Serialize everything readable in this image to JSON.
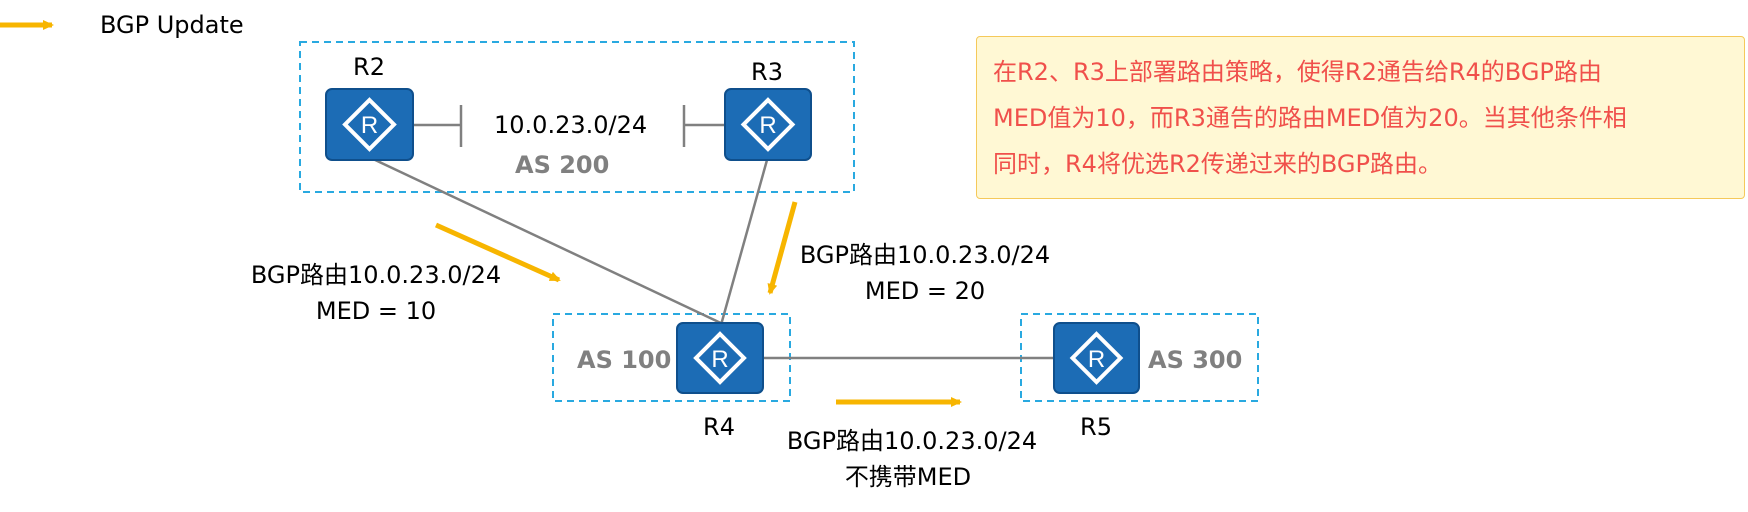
{
  "colors": {
    "as_box_border": "#29a9e0",
    "router_fill": "#1c6cb5",
    "router_outline": "#0f4f8c",
    "link_line": "#808080",
    "arrow": "#f7b500",
    "as_label": "#808080",
    "note_text": "#f0504b",
    "note_background": "#fff8d4",
    "note_border": "#f5c95a"
  },
  "legend": {
    "label": "BGP Update",
    "icon": "yellow-arrow"
  },
  "as_areas": {
    "as200": "AS 200",
    "as100": "AS 100",
    "as300": "AS 300"
  },
  "routers": {
    "r2": {
      "name": "R2",
      "icon": "router-icon",
      "glyph": "R"
    },
    "r3": {
      "name": "R3",
      "icon": "router-icon",
      "glyph": "R"
    },
    "r4": {
      "name": "R4",
      "icon": "router-icon",
      "glyph": "R"
    },
    "r5": {
      "name": "R5",
      "icon": "router-icon",
      "glyph": "R"
    }
  },
  "network_label": "10.0.23.0/24",
  "updates": {
    "r2_to_r4": {
      "line1": "BGP路由10.0.23.0/24",
      "line2": "MED = 10"
    },
    "r3_to_r4": {
      "line1": "BGP路由10.0.23.0/24",
      "line2": "MED = 20"
    },
    "r4_to_r5": {
      "line1": "BGP路由10.0.23.0/24",
      "line2": "不携带MED"
    }
  },
  "note": {
    "lines": [
      "在R2、R3上部署路由策略，使得R2通告给R4的BGP路由",
      "MED值为10，而R3通告的路由MED值为20。当其他条件相",
      "同时，R4将优选R2传递过来的BGP路由。"
    ]
  }
}
